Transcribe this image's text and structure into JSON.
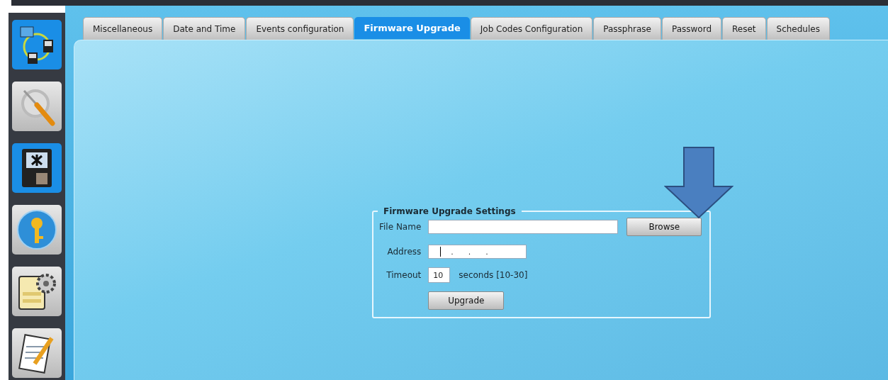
{
  "sidebar": {
    "items": [
      {
        "kind": "network",
        "selected": true
      },
      {
        "kind": "tools",
        "selected": false
      },
      {
        "kind": "terminal",
        "selected": true
      },
      {
        "kind": "key",
        "selected": false
      },
      {
        "kind": "settings",
        "selected": false
      },
      {
        "kind": "notepad",
        "selected": false
      }
    ]
  },
  "tabs": [
    {
      "label": "Miscellaneous",
      "selected": false
    },
    {
      "label": "Date and Time",
      "selected": false
    },
    {
      "label": "Events configuration",
      "selected": false
    },
    {
      "label": "Firmware Upgrade",
      "selected": true
    },
    {
      "label": "Job Codes Configuration",
      "selected": false
    },
    {
      "label": "Passphrase",
      "selected": false
    },
    {
      "label": "Password",
      "selected": false
    },
    {
      "label": "Reset",
      "selected": false
    },
    {
      "label": "Schedules",
      "selected": false
    }
  ],
  "settings": {
    "title": "Firmware Upgrade Settings",
    "file_name": {
      "label": "File Name"
    },
    "browse_button": "Browse",
    "address": {
      "label": "Address",
      "value": ".      .      ."
    },
    "timeout": {
      "label": "Timeout",
      "value": "10",
      "hint": "seconds [10-30]"
    },
    "upgrade_button": "Upgrade"
  }
}
